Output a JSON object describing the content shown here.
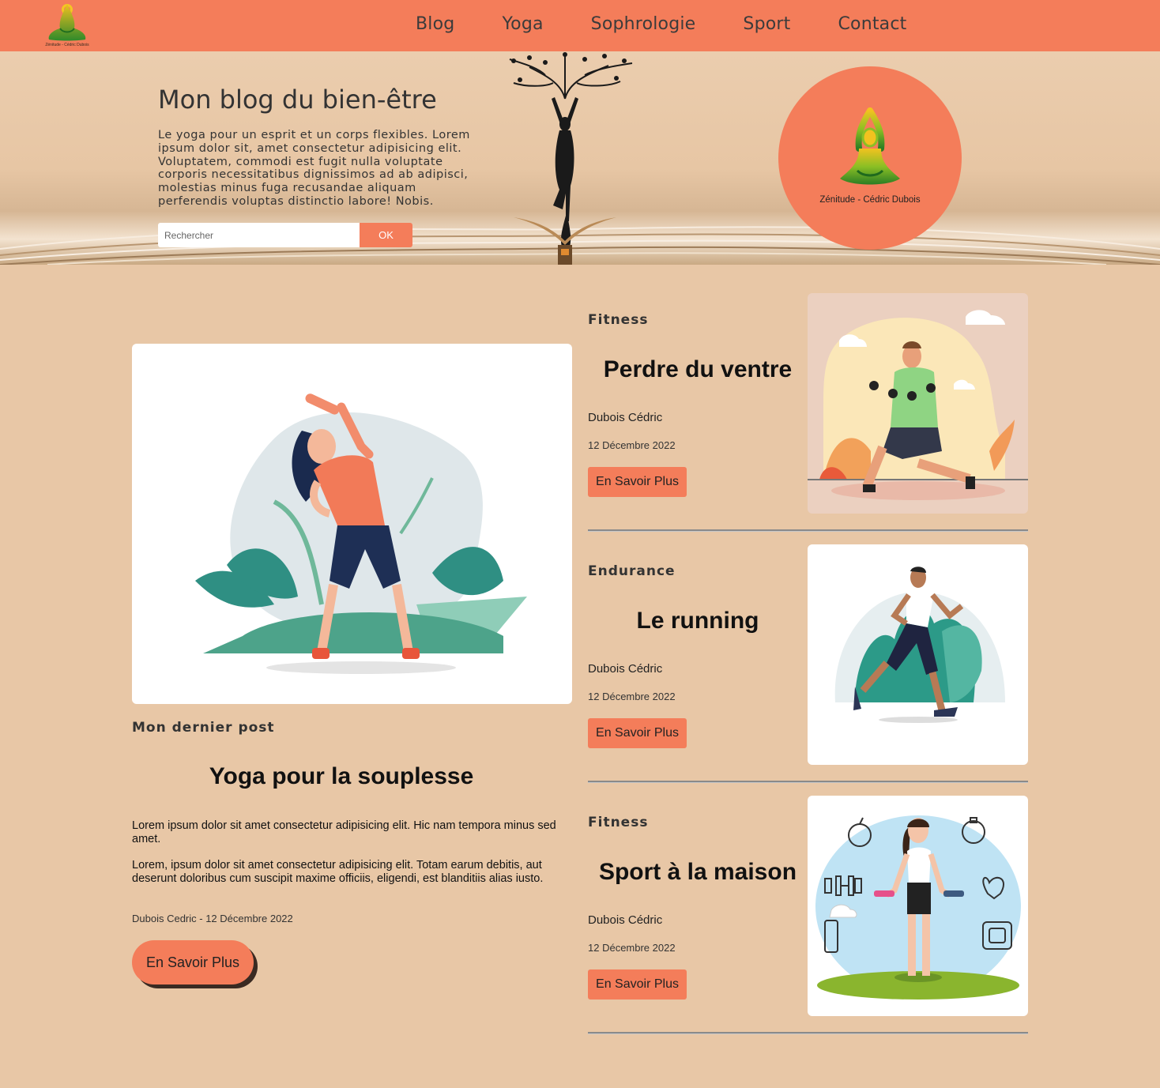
{
  "nav": {
    "logo_text": "Zénitude - Cédric Dubois",
    "links": [
      "Blog",
      "Yoga",
      "Sophrologie",
      "Sport",
      "Contact"
    ]
  },
  "hero": {
    "title": "Mon blog du bien-être",
    "text": "Le yoga pour un esprit et un corps flexibles. Lorem ipsum dolor sit, amet consectetur adipisicing elit. Voluptatem, commodi est fugit nulla voluptate corporis necessitatibus dignissimos ad ab adipisci, molestias minus fuga recusandae aliquam perferendis voluptas distinctio labore! Nobis.",
    "search_placeholder": "Rechercher",
    "search_button": "OK",
    "circle_text": "Zénitude - Cédric Dubois"
  },
  "main_post": {
    "category": "Mon dernier post",
    "title": "Yoga pour la souplesse",
    "paragraph1": "Lorem ipsum dolor sit amet consectetur adipisicing elit. Hic nam tempora minus sed amet.",
    "paragraph2": "Lorem, ipsum dolor sit amet consectetur adipisicing elit. Totam earum debitis, aut deserunt doloribus cum suscipit maxime officiis, eligendi, est blanditiis alias iusto.",
    "meta": "Dubois Cedric - 12 Décembre 2022",
    "button": "En Savoir Plus"
  },
  "posts": [
    {
      "category": "Fitness",
      "title": "Perdre du ventre",
      "author": "Dubois Cédric",
      "date": "12 Décembre 2022",
      "button": "En Savoir Plus"
    },
    {
      "category": "Endurance",
      "title": "Le running",
      "author": "Dubois Cédric",
      "date": "12 Décembre 2022",
      "button": "En Savoir Plus"
    },
    {
      "category": "Fitness",
      "title": "Sport à la maison",
      "author": "Dubois Cédric",
      "date": "12 Décembre 2022",
      "button": "En Savoir Plus"
    }
  ],
  "colors": {
    "accent": "#f47d5a",
    "background": "#e8c7a6"
  }
}
